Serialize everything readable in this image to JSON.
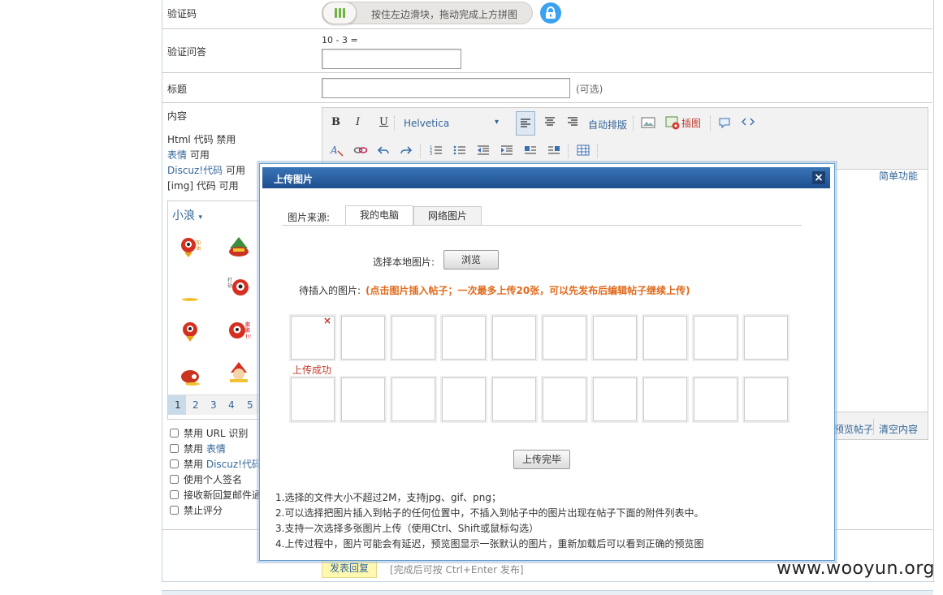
{
  "form": {
    "captcha_label": "验证码",
    "captcha_slider_text": "按住左边滑块，拖动完成上方拼图",
    "question_label": "验证问答",
    "question_text": "10 - 3 =",
    "title_label": "标题",
    "title_hint": "(可选)",
    "content_label": "内容",
    "html_code": "Html 代码 禁用",
    "smiley_link": "表情",
    "smiley_status": " 可用",
    "discuz_link": "Discuz!代码",
    "discuz_status": " 可用",
    "img_code": "[img] 代码 可用"
  },
  "toolbar": {
    "bold": "B",
    "italic": "I",
    "underline": "U",
    "font": "Helvetica",
    "auto_layout": "自动排版",
    "insert_image": "插图",
    "simple_mode": "简单功能",
    "preview_post": "预览帖子",
    "clear_content": "清空内容"
  },
  "smiley": {
    "category": "小浪",
    "pages": [
      "1",
      "2",
      "3",
      "4",
      "5"
    ]
  },
  "options": [
    {
      "prefix": "禁用 URL 识别",
      "link": ""
    },
    {
      "prefix": "禁用 ",
      "link": "表情"
    },
    {
      "prefix": "禁用 ",
      "link": "Discuz!代码"
    },
    {
      "prefix": "使用个人签名",
      "link": ""
    },
    {
      "prefix": "接收新回复邮件通知",
      "link": ""
    },
    {
      "prefix": "禁止评分",
      "link": ""
    }
  ],
  "submit": {
    "button": "发表回复",
    "hint": "[完成后可按 Ctrl+Enter 发布]"
  },
  "dialog": {
    "title": "上传图片",
    "source_label": "图片来源:",
    "tab_local": "我的电脑",
    "tab_web": "网络图片",
    "select_label": "选择本地图片:",
    "browse": "浏览",
    "pending_label": "待插入的图片:",
    "pending_hint": "(点击图片插入帖子；一次最多上传20张，可以先发布后编辑帖子继续上传)",
    "upload_success": "上传成功",
    "done_button": "上传完毕",
    "notes": [
      "1.选择的文件大小不超过2M，支持jpg、gif、png；",
      "2.可以选择把图片插入到帖子的任何位置中，不插入到帖子中的图片出现在帖子下面的附件列表中。",
      "3.支持一次选择多张图片上传（使用Ctrl、Shift或鼠标勾选）",
      "4.上传过程中，图片可能会有延迟，预览图显示一张默认的图片，重新加载后可以看到正确的预览图"
    ]
  },
  "watermark": "www.wooyun.org",
  "colors": {
    "dialog_title_bar": "#2b62a5",
    "hint_orange": "#e06a1b",
    "success_red": "#c0392b",
    "submit_bg": "#fff8b0",
    "lock_blue": "#3aa2f0",
    "slider_green": "#6cb33f"
  }
}
